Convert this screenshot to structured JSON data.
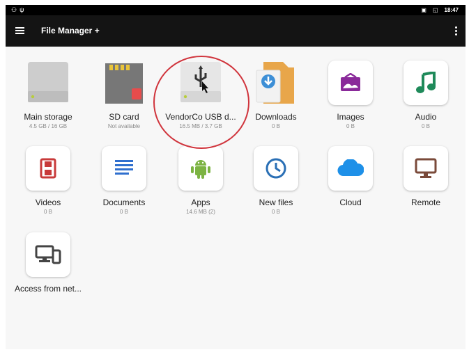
{
  "status_bar": {
    "time": "18:47"
  },
  "toolbar": {
    "title": "File Manager +"
  },
  "items": [
    {
      "label": "Main storage",
      "sub": "4.5 GB / 16 GB",
      "icon": "storage-drive-icon"
    },
    {
      "label": "SD card",
      "sub": "Not available",
      "icon": "sd-card-icon"
    },
    {
      "label": "VendorCo USB d...",
      "sub": "16.5 MB / 3.7 GB",
      "icon": "usb-drive-icon"
    },
    {
      "label": "Downloads",
      "sub": "0 B",
      "icon": "downloads-folder-icon"
    },
    {
      "label": "Images",
      "sub": "0 B",
      "icon": "images-icon"
    },
    {
      "label": "Audio",
      "sub": "0 B",
      "icon": "audio-icon"
    },
    {
      "label": "Videos",
      "sub": "0 B",
      "icon": "videos-icon"
    },
    {
      "label": "Documents",
      "sub": "0 B",
      "icon": "documents-icon"
    },
    {
      "label": "Apps",
      "sub": "14.6 MB (2)",
      "icon": "android-apps-icon"
    },
    {
      "label": "New files",
      "sub": "0 B",
      "icon": "clock-icon"
    },
    {
      "label": "Cloud",
      "sub": "",
      "icon": "cloud-icon"
    },
    {
      "label": "Remote",
      "sub": "",
      "icon": "monitor-icon"
    },
    {
      "label": "Access from net...",
      "sub": "",
      "icon": "network-devices-icon"
    }
  ],
  "colors": {
    "annotation_circle": "#d0343c",
    "images": "#8a2a9a",
    "audio": "#1f8a5a",
    "videos": "#c83a3a",
    "documents": "#2f6fce",
    "apps": "#7cb342",
    "new_files": "#2a6fb5",
    "cloud": "#1e90e8",
    "remote": "#7a4a3a"
  }
}
